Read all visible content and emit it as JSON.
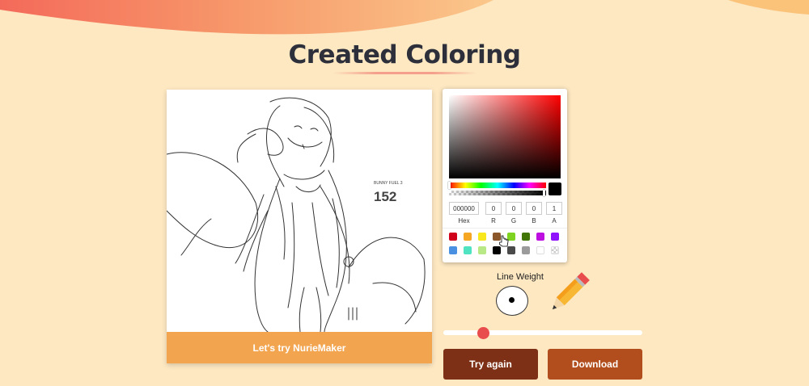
{
  "page": {
    "title": "Created Coloring"
  },
  "canvas": {
    "try_label": "Let's try NurieMaker",
    "artwork_text_small": "BUNNY FUEL 3",
    "artwork_text_big": "152"
  },
  "picker": {
    "fields": [
      {
        "label": "Hex",
        "value": "000000"
      },
      {
        "label": "R",
        "value": "0"
      },
      {
        "label": "G",
        "value": "0"
      },
      {
        "label": "B",
        "value": "0"
      },
      {
        "label": "A",
        "value": "1"
      }
    ],
    "selected_color": "#000000",
    "swatches": [
      "#d0021b",
      "#f5a623",
      "#f8e71c",
      "#8b572a",
      "#7ed321",
      "#417505",
      "#bd10e0",
      "#9013fe",
      "#4a90e2",
      "#50e3c2",
      "#b8e986",
      "#000000",
      "#4a4a4a",
      "#9b9b9b",
      "#ffffff",
      "transparent"
    ]
  },
  "tools": {
    "line_weight_label": "Line Weight",
    "slider_value": 0.2
  },
  "buttons": {
    "try_again": "Try again",
    "download": "Download"
  },
  "colors": {
    "background": "#fde8c2",
    "accent_orange": "#f2a44f",
    "try_again_bg": "#7d3016",
    "download_bg": "#b24e1d",
    "slider_thumb": "#e94c4c"
  },
  "icons": [
    "pencil-icon",
    "pointer-cursor-icon"
  ]
}
